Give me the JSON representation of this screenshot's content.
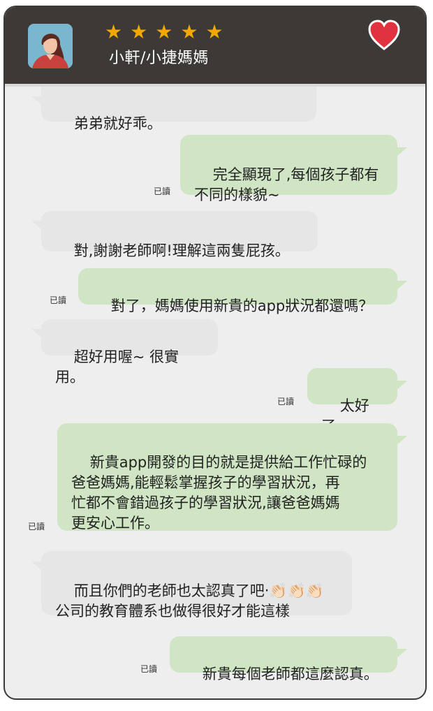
{
  "header": {
    "title": "小軒/小捷媽媽",
    "rating_stars": 5,
    "star_char": "★",
    "favorite_icon": "heart-icon",
    "colors": {
      "bar": "#3d3936",
      "star": "#f3a800",
      "heart": "#e0333f"
    }
  },
  "read_label": "已讀",
  "messages": [
    {
      "side": "in",
      "text": "弟弟就好乖。"
    },
    {
      "side": "out",
      "text": "完全顯現了,每個孩子都有\n不同的樣貌~",
      "read": "已讀"
    },
    {
      "side": "in",
      "text": "對,謝謝老師啊!理解這兩隻屁孩。"
    },
    {
      "side": "out",
      "text": "對了，媽媽使用新貴的app狀況都還嗎？",
      "read": "已讀"
    },
    {
      "side": "in",
      "text": "超好用喔~ 很實用。"
    },
    {
      "side": "out",
      "text": "太好了。",
      "read": "已讀"
    },
    {
      "side": "out",
      "text": "新貴app開發的目的就是提供給工作忙碌的\n爸爸媽媽,能輕鬆掌握孩子的學習狀況，再\n忙都不會錯過孩子的學習狀況,讓爸爸媽媽\n更安心工作。",
      "read": "已讀"
    },
    {
      "side": "in",
      "text": "而且你們的老師也太認真了吧‧👏🏻👏🏻👏🏻\n公司的教育體系也做得很好才能這樣"
    },
    {
      "side": "out",
      "text": "新貴每個老師都這麼認真。",
      "read": "已讀"
    }
  ]
}
